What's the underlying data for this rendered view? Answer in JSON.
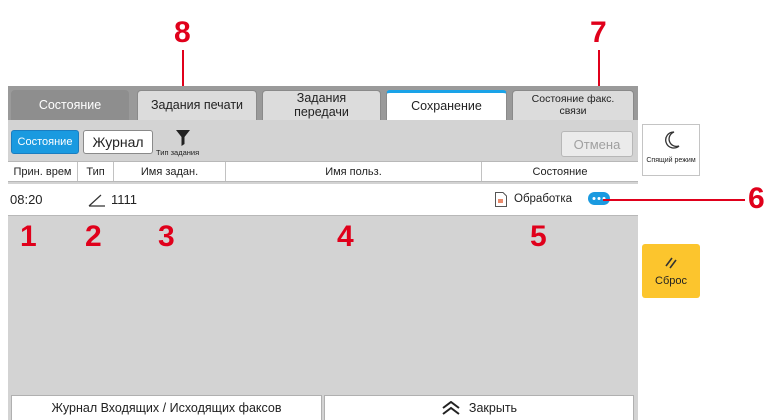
{
  "callouts": {
    "c1": "1",
    "c2": "2",
    "c3": "3",
    "c4": "4",
    "c5": "5",
    "c6": "6",
    "c7": "7",
    "c8": "8"
  },
  "tabs": [
    {
      "label": "Состояние"
    },
    {
      "label": "Задания печати"
    },
    {
      "label_line1": "Задания",
      "label_line2": "передачи"
    },
    {
      "label": "Сохранение"
    },
    {
      "label_line1": "Состояние факс.",
      "label_line2": "связи"
    }
  ],
  "toolbar": {
    "state_label": "Состояние",
    "journal_label": "Журнал",
    "filter_label": "Тип задания",
    "cancel_label": "Отмена"
  },
  "table": {
    "headers": [
      "Прин. врем",
      "Тип",
      "Имя задан.",
      "Имя польз.",
      "Состояние"
    ],
    "rows": [
      {
        "time": "08:20",
        "type_icon": "scan-icon",
        "job_name": "1111",
        "user": "",
        "status": "Обработка",
        "status_icon": "document-icon"
      }
    ]
  },
  "bottom": {
    "fax_log_label": "Журнал Входящих / Исходящих факсов",
    "close_label": "Закрыть"
  },
  "side": {
    "sleep_label": "Спящий режим",
    "reset_label": "Сброс"
  },
  "colors": {
    "accent": "#1a9ae0",
    "callout": "#e0001b",
    "reset": "#fcc52d"
  }
}
